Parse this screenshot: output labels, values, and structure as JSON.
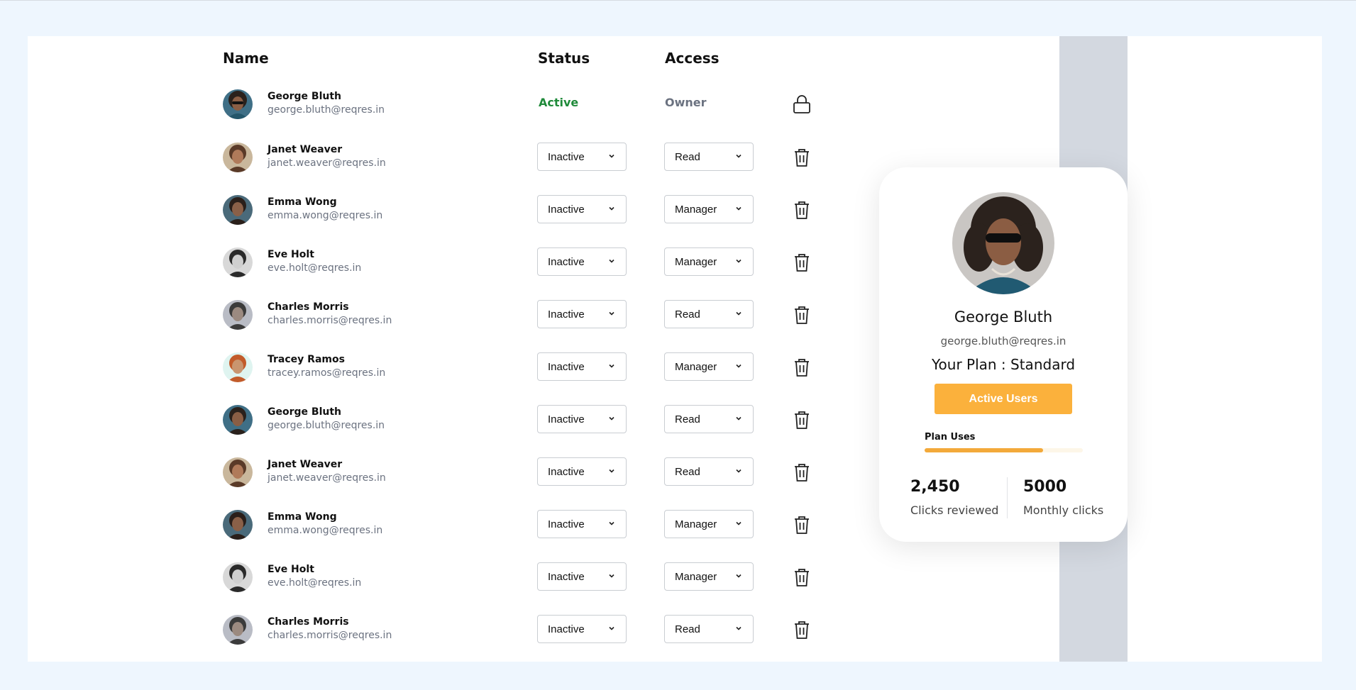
{
  "table": {
    "headers": {
      "name": "Name",
      "status": "Status",
      "access": "Access"
    },
    "owner_row": {
      "name": "George Bluth",
      "email": "george.bluth@reqres.in",
      "status": "Active",
      "access": "Owner",
      "icon": "lock-icon"
    },
    "rows": [
      {
        "name": "Janet Weaver",
        "email": "janet.weaver@reqres.in",
        "status": "Inactive",
        "access": "Read"
      },
      {
        "name": "Emma Wong",
        "email": "emma.wong@reqres.in",
        "status": "Inactive",
        "access": "Manager"
      },
      {
        "name": "Eve Holt",
        "email": "eve.holt@reqres.in",
        "status": "Inactive",
        "access": "Manager"
      },
      {
        "name": "Charles Morris",
        "email": "charles.morris@reqres.in",
        "status": "Inactive",
        "access": "Read"
      },
      {
        "name": "Tracey Ramos",
        "email": "tracey.ramos@reqres.in",
        "status": "Inactive",
        "access": "Manager"
      },
      {
        "name": "George Bluth",
        "email": "george.bluth@reqres.in",
        "status": "Inactive",
        "access": "Read"
      },
      {
        "name": "Janet Weaver",
        "email": "janet.weaver@reqres.in",
        "status": "Inactive",
        "access": "Read"
      },
      {
        "name": "Emma Wong",
        "email": "emma.wong@reqres.in",
        "status": "Inactive",
        "access": "Manager"
      },
      {
        "name": "Eve Holt",
        "email": "eve.holt@reqres.in",
        "status": "Inactive",
        "access": "Manager"
      },
      {
        "name": "Charles Morris",
        "email": "charles.morris@reqres.in",
        "status": "Inactive",
        "access": "Read"
      }
    ],
    "row_icon": "trash-icon"
  },
  "profile_card": {
    "name": "George Bluth",
    "email": "george.bluth@reqres.in",
    "plan": "Your Plan : Standard",
    "button_label": "Active Users",
    "plan_uses_label": "Plan Uses",
    "plan_uses_fraction": 0.75,
    "stats": [
      {
        "value": "2,450",
        "label": "Clicks reviewed"
      },
      {
        "value": "5000",
        "label": "Monthly clicks"
      }
    ]
  },
  "colors": {
    "active_status": "#1f8a3a",
    "accent_button": "#fbb13c",
    "progress_fill": "#f3a93a",
    "page_background": "#eef6fe",
    "sidebar_strip": "#d3d8e0"
  }
}
